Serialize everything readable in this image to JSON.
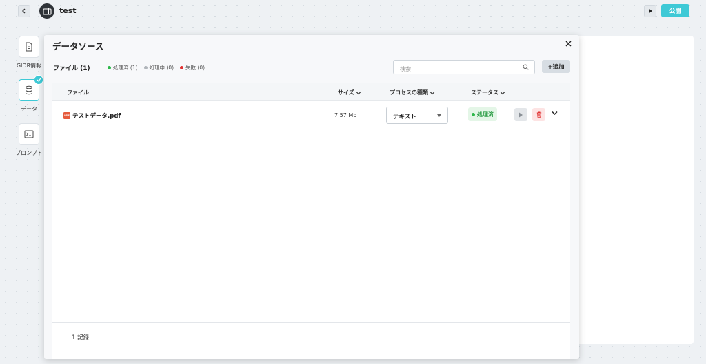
{
  "topbar": {
    "title": "test",
    "publish_label": "公開",
    "back_icon": "chevron-left-icon",
    "run_icon": "play-icon",
    "accent_color": "#3ec9d6"
  },
  "rail": {
    "items": [
      {
        "label": "GIDR情報",
        "icon": "document-icon",
        "active": false
      },
      {
        "label": "データ",
        "icon": "database-icon",
        "active": true
      },
      {
        "label": "プロンプト",
        "icon": "terminal-icon",
        "active": false
      }
    ]
  },
  "modal": {
    "title": "データソース",
    "file_count": "ファイル (1)",
    "legend": [
      {
        "label": "処理済 (1)",
        "color": "#2eb84b"
      },
      {
        "label": "処理中 (0)",
        "color": "#b0b5ba"
      },
      {
        "label": "失敗 (0)",
        "color": "#e03131"
      }
    ],
    "search_placeholder": "検索",
    "add_label": "+追加",
    "columns": {
      "file": "ファイル",
      "size": "サイズ",
      "process_type": "プロセスの種類",
      "status": "ステータス"
    },
    "rows": [
      {
        "name": "テストデータ.pdf",
        "size": "7.57 Mb",
        "process_type": "テキスト",
        "status": "処理済",
        "status_color": "#2e9e48"
      }
    ],
    "record_count": "1 記録"
  }
}
